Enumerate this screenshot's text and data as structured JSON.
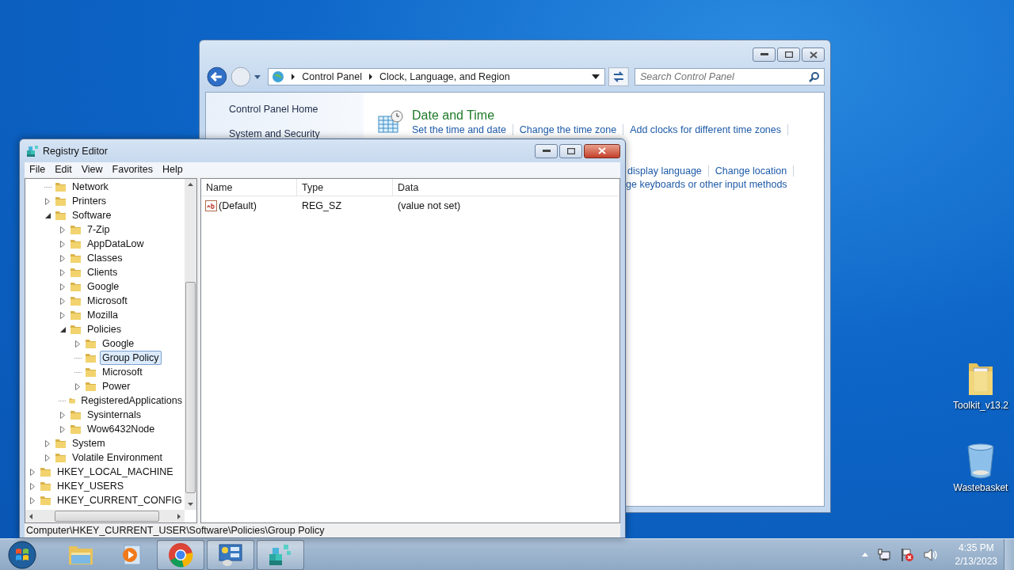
{
  "desktop_icons": [
    {
      "label": "Toolkit_v13.2",
      "kind": "folder"
    },
    {
      "label": "Wastebasket",
      "kind": "bin"
    }
  ],
  "control_panel": {
    "address": [
      "Control Panel",
      "Clock, Language, and Region"
    ],
    "search": {
      "placeholder": "Search Control Panel"
    },
    "sidebar": [
      "Control Panel Home",
      "System and Security"
    ],
    "category": {
      "title": "Date and Time",
      "links": [
        "Set the time and date",
        "Change the time zone",
        "Add clocks for different time zones"
      ]
    },
    "partial_links": [
      [
        "display language",
        "Change location"
      ],
      [
        "ge keyboards or other input methods"
      ]
    ]
  },
  "registry": {
    "title": "Registry Editor",
    "menu": [
      "File",
      "Edit",
      "View",
      "Favorites",
      "Help"
    ],
    "tree": [
      {
        "children": [
          {
            "label": "Network",
            "selected": false
          },
          {
            "label": "Printers",
            "expanded": false,
            "selected": false
          },
          {
            "label": "Software",
            "expanded": true,
            "selected": false,
            "children": [
              {
                "label": "7-Zip",
                "expanded": false,
                "selected": false
              },
              {
                "label": "AppDataLow",
                "expanded": false,
                "selected": false
              },
              {
                "label": "Classes",
                "expanded": false,
                "selected": false
              },
              {
                "label": "Clients",
                "expanded": false,
                "selected": false
              },
              {
                "label": "Google",
                "expanded": false,
                "selected": false
              },
              {
                "label": "Microsoft",
                "expanded": false,
                "selected": false
              },
              {
                "label": "Mozilla",
                "expanded": false,
                "selected": false
              },
              {
                "label": "Policies",
                "expanded": true,
                "selected": false,
                "children": [
                  {
                    "label": "Google",
                    "expanded": false,
                    "selected": false
                  },
                  {
                    "label": "Group Policy",
                    "selected": true
                  },
                  {
                    "label": "Microsoft",
                    "selected": false
                  },
                  {
                    "label": "Power",
                    "expanded": false,
                    "selected": false
                  }
                ]
              },
              {
                "label": "RegisteredApplications",
                "selected": false
              },
              {
                "label": "Sysinternals",
                "expanded": false,
                "selected": false
              },
              {
                "label": "Wow6432Node",
                "expanded": false,
                "selected": false
              }
            ]
          },
          {
            "label": "System",
            "expanded": false,
            "selected": false
          },
          {
            "label": "Volatile Environment",
            "expanded": false,
            "selected": false
          }
        ]
      },
      {
        "label": "HKEY_LOCAL_MACHINE",
        "expanded": false,
        "selected": false
      },
      {
        "label": "HKEY_USERS",
        "expanded": false,
        "selected": false
      },
      {
        "label": "HKEY_CURRENT_CONFIG",
        "expanded": false,
        "selected": false
      }
    ],
    "columns": [
      "Name",
      "Type",
      "Data"
    ],
    "rows": [
      {
        "name": "(Default)",
        "type": "REG_SZ",
        "data": "(value not set)"
      }
    ],
    "status_bar": "Computer\\HKEY_CURRENT_USER\\Software\\Policies\\Group Policy"
  },
  "taskbar": {
    "apps": [
      {
        "kind": "explorer",
        "running": false
      },
      {
        "kind": "media",
        "running": false
      },
      {
        "kind": "browser",
        "running": true
      },
      {
        "kind": "control-panel",
        "running": true
      },
      {
        "kind": "registry",
        "running": true
      }
    ],
    "clock": {
      "time": "4:35 PM",
      "date": "2/13/2023"
    }
  }
}
